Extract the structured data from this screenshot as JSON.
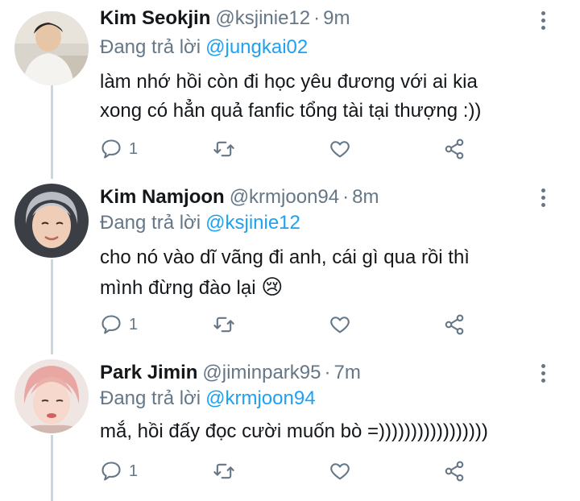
{
  "tweets": [
    {
      "name": "Kim Seokjin",
      "handle": "@ksjinie12",
      "separator": "·",
      "time": "9m",
      "reply_prefix": "Đang trả lời",
      "reply_to": "@jungkai02",
      "text_line1": "làm nhớ hồi còn đi học yêu đương với ai kia",
      "text_line2": "xong có hẳn quả fanfic tổng tài tại thượng :))",
      "reply_count": "1"
    },
    {
      "name": "Kim Namjoon",
      "handle": "@krmjoon94",
      "separator": "·",
      "time": "8m",
      "reply_prefix": "Đang trả lời",
      "reply_to": "@ksjinie12",
      "text_line1": "cho nó vào dĩ vãng đi anh, cái gì qua rồi thì",
      "text_line2": "mình đừng đào lại",
      "emoji": "😢",
      "reply_count": "1"
    },
    {
      "name": "Park Jimin",
      "handle": "@jiminpark95",
      "separator": "·",
      "time": "7m",
      "reply_prefix": "Đang trả lời",
      "reply_to": "@krmjoon94",
      "text_line1": "mắ, hồi đấy đọc cười muốn bò =)))))))))))))))))",
      "reply_count": "1"
    }
  ],
  "colors": {
    "text": "#14171a",
    "muted": "#657786",
    "mention": "#1da1f2",
    "thread_line": "#ccd6dd"
  },
  "icons": [
    "reply-icon",
    "retweet-icon",
    "like-icon",
    "share-icon",
    "more-icon"
  ]
}
